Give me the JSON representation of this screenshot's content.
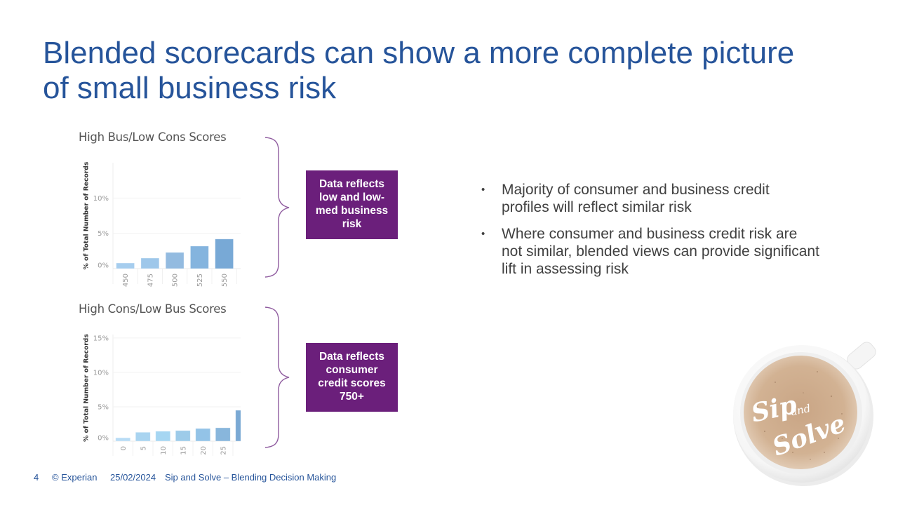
{
  "slide": {
    "title_lines": [
      "Blended scorecards can show a more complete picture",
      "of small business risk"
    ]
  },
  "chart_data": [
    {
      "type": "bar",
      "title": "High Bus/Low Cons Scores",
      "xlabel": "",
      "ylabel": "% of Total Number of Records",
      "categories": [
        "450",
        "475",
        "500",
        "525",
        "550"
      ],
      "values": [
        0.8,
        1.5,
        2.3,
        3.2,
        4.2
      ],
      "value_unit": "%",
      "ylim": [
        0,
        15
      ],
      "yticks": [
        0,
        5,
        10
      ],
      "ytick_labels": [
        "0%",
        "5%",
        "10%"
      ],
      "grid": true,
      "legend": "none",
      "colors": [
        "#a6cdee",
        "#9ec7ea",
        "#93bbe0",
        "#84b4de",
        "#78a9d6"
      ]
    },
    {
      "type": "bar",
      "title": "High Cons/Low Bus Scores",
      "xlabel": "",
      "ylabel": "% of Total Number of Records",
      "categories": [
        "0",
        "5",
        "10",
        "15",
        "20",
        "25",
        ""
      ],
      "values": [
        0.5,
        1.3,
        1.45,
        1.55,
        1.85,
        1.95,
        4.5
      ],
      "value_unit": "%",
      "ylim": [
        0,
        15.5
      ],
      "yticks": [
        0,
        5,
        10,
        15
      ],
      "ytick_labels": [
        "0%",
        "5%",
        "10%",
        "15%"
      ],
      "grid": true,
      "legend": "none",
      "colors": [
        "#b8dcf5",
        "#a9d4f0",
        "#a6d6f2",
        "#9dcbe9",
        "#93c3e7",
        "#88b6dc",
        "#7aa9d4"
      ]
    }
  ],
  "callouts": [
    {
      "lines": [
        "Data reflects",
        "low and low-",
        "med business",
        "risk"
      ]
    },
    {
      "lines": [
        "Data reflects",
        "consumer",
        "credit scores",
        "750+"
      ]
    }
  ],
  "bullets": [
    {
      "lines": [
        "Majority of consumer  and business credit",
        "profiles will reflect similar risk"
      ]
    },
    {
      "lines": [
        "Where consumer and business credit risk are",
        "not similar, blended  views can provide significant",
        "lift in assessing risk"
      ]
    }
  ],
  "bullet_glyph": "•",
  "footer": {
    "page_number": "4",
    "copyright": "© Experian",
    "date": "25/02/2024",
    "presentation_title": "Sip and Solve  – Blending Decision Making"
  },
  "logo": {
    "word1": "Sip",
    "word2": "and",
    "word3": "Solve"
  },
  "colors": {
    "title": "#26549a",
    "callout_background": "#6b1f7b",
    "bracket": "#8e5a9e",
    "body_text": "#404040",
    "footer_text": "#26549a"
  }
}
